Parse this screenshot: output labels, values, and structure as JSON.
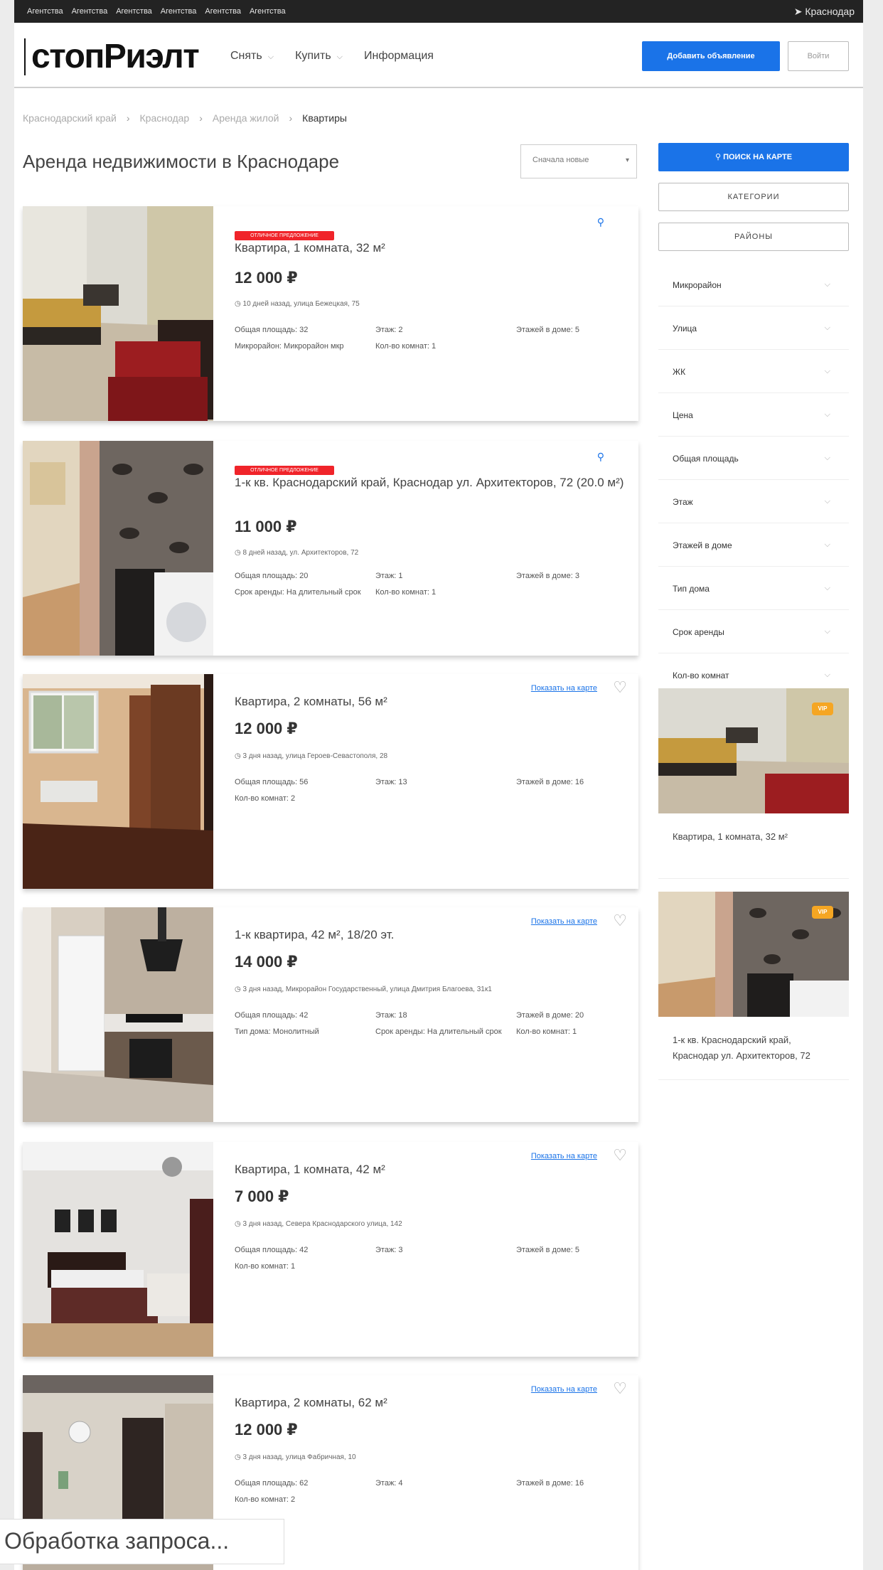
{
  "topbar": {
    "links": [
      "Агентства",
      "Агентства",
      "Агентства",
      "Агентства",
      "Агентства",
      "Агентства"
    ],
    "city": "Краснодар"
  },
  "header": {
    "logo": "стопРиэлт",
    "nav": [
      "Снять",
      "Купить",
      "Информация"
    ],
    "add_button": "Добавить объявление",
    "login_button": "Войти"
  },
  "breadcrumbs": [
    "Краснодарский край",
    "Краснодар",
    "Аренда жилой",
    "Квартиры"
  ],
  "page_title": "Аренда недвижимости в Краснодаре",
  "sort": {
    "value": "Сначала новые"
  },
  "listings": [
    {
      "badge": "ОТЛИЧНОЕ ПРЕДЛОЖЕНИЕ",
      "title": "Квартира, 1 комната, 32 м²",
      "price": "12 000 ₽",
      "address": "10 дней назад, улица Бежецкая, 75",
      "params": [
        "Общая площадь: 32",
        "Этаж: 2",
        "Этажей в доме: 5",
        "Микрорайон: Микрорайон мкр",
        "Кол-во комнат: 1"
      ],
      "map_link": ""
    },
    {
      "badge": "ОТЛИЧНОЕ ПРЕДЛОЖЕНИЕ",
      "title": "1-к кв. Краснодарский край, Краснодар ул. Архитекторов, 72 (20.0 м²)",
      "price": "11 000 ₽",
      "address": "8 дней назад, ул. Архитекторов, 72",
      "params": [
        "Общая площадь: 20",
        "Этаж: 1",
        "Этажей в доме: 3",
        "Срок аренды: На длительный срок",
        "Кол-во комнат: 1"
      ],
      "map_link": ""
    },
    {
      "badge": "",
      "title": "Квартира, 2 комнаты, 56 м²",
      "price": "12 000 ₽",
      "address": "3 дня назад, улица Героев-Севастополя, 28",
      "params": [
        "Общая площадь: 56",
        "Этаж: 13",
        "Этажей в доме: 16",
        "Кол-во комнат: 2"
      ],
      "map_link": "Показать на карте"
    },
    {
      "badge": "",
      "title": "1-к квартира, 42 м², 18/20 эт.",
      "price": "14 000 ₽",
      "address": "3 дня назад, Микрорайон Государственный, улица Дмитрия Благоева, 31к1",
      "params": [
        "Общая площадь: 42",
        "Этаж: 18",
        "Этажей в доме: 20",
        "Тип дома: Монолитный",
        "Срок аренды: На длительный срок",
        "Кол-во комнат: 1"
      ],
      "map_link": "Показать на карте"
    },
    {
      "badge": "",
      "title": "Квартира, 1 комната, 42 м²",
      "price": "7 000 ₽",
      "address": "3 дня назад, Севера Краснодарского улица, 142",
      "params": [
        "Общая площадь: 42",
        "Этаж: 3",
        "Этажей в доме: 5",
        "Кол-во комнат: 1"
      ],
      "map_link": "Показать на карте"
    },
    {
      "badge": "",
      "title": "Квартира, 2 комнаты, 62 м²",
      "price": "12 000 ₽",
      "address": "3 дня назад, улица Фабричная, 10",
      "params": [
        "Общая площадь: 62",
        "Этаж: 4",
        "Этажей в доме: 16",
        "Кол-во комнат: 2"
      ],
      "map_link": "Показать на карте"
    }
  ],
  "sidebar": {
    "map_button": "ПОИСК НА КАРТЕ",
    "categories_button": "КАТЕГОРИИ",
    "districts_button": "РАЙОНЫ",
    "filters": [
      "Микрорайон",
      "Улица",
      "ЖК",
      "Цена",
      "Общая площадь",
      "Этаж",
      "Этажей в доме",
      "Тип дома",
      "Срок аренды",
      "Кол-во комнат"
    ],
    "vip": [
      {
        "badge": "VIP",
        "title": "Квартира, 1 комната, 32 м²"
      },
      {
        "badge": "VIP",
        "title": "1-к кв. Краснодарский край, Краснодар ул. Архитекторов, 72"
      }
    ]
  },
  "status": {
    "loading": "Обработка запроса..."
  },
  "colors": {
    "accent": "#1a73e8",
    "badge_red": "#f0242a",
    "vip": "#f5a623",
    "topbar": "#232323"
  }
}
